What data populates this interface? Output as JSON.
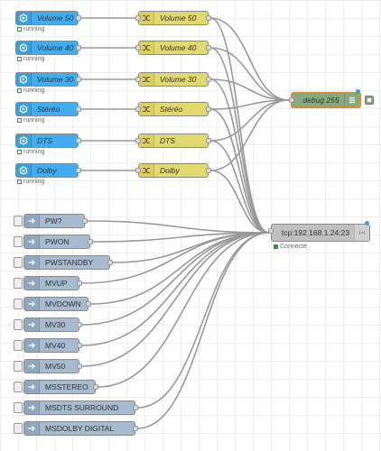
{
  "colors": {
    "inject_blue": "#3fadf0",
    "change_yellow": "#e2d96e",
    "inject_gray": "#a6bbcf",
    "debug_green": "#87a980",
    "tcp_gray": "#c0c0c0",
    "wire": "#999999"
  },
  "inject_nodes": [
    {
      "label": "Volume 50",
      "status": "running",
      "icon": "inject-icon"
    },
    {
      "label": "Volume 40",
      "status": "running",
      "icon": "inject-icon"
    },
    {
      "label": "Volume 30",
      "status": "running",
      "icon": "inject-icon"
    },
    {
      "label": "Stéréo",
      "status": "running",
      "icon": "inject-icon"
    },
    {
      "label": "DTS",
      "status": "running",
      "icon": "inject-icon"
    },
    {
      "label": "Dolby",
      "status": "running",
      "icon": "inject-icon"
    }
  ],
  "change_nodes": [
    {
      "label": "Volume 50",
      "icon": "shuffle-icon"
    },
    {
      "label": "Volume 40",
      "icon": "shuffle-icon"
    },
    {
      "label": "Volume 30",
      "icon": "shuffle-icon"
    },
    {
      "label": "Stéréo",
      "icon": "shuffle-icon"
    },
    {
      "label": "DTS",
      "icon": "shuffle-icon"
    },
    {
      "label": "Dolby",
      "icon": "shuffle-icon"
    }
  ],
  "debug_node": {
    "label": "debug 255",
    "icon": "list-icon"
  },
  "tcp_node": {
    "label": "tcp:192.168.1.24:23",
    "status": "Connecté",
    "icon": "broadcast-icon"
  },
  "command_nodes": [
    {
      "label": "PW?"
    },
    {
      "label": "PWON"
    },
    {
      "label": "PWSTANDBY"
    },
    {
      "label": "MVUP"
    },
    {
      "label": "MVDOWN"
    },
    {
      "label": "MV30"
    },
    {
      "label": "MV40"
    },
    {
      "label": "MV50"
    },
    {
      "label": "MSSTEREO"
    },
    {
      "label": "MSDTS SURROUND"
    },
    {
      "label": "MSDOLBY DIGITAL"
    }
  ]
}
